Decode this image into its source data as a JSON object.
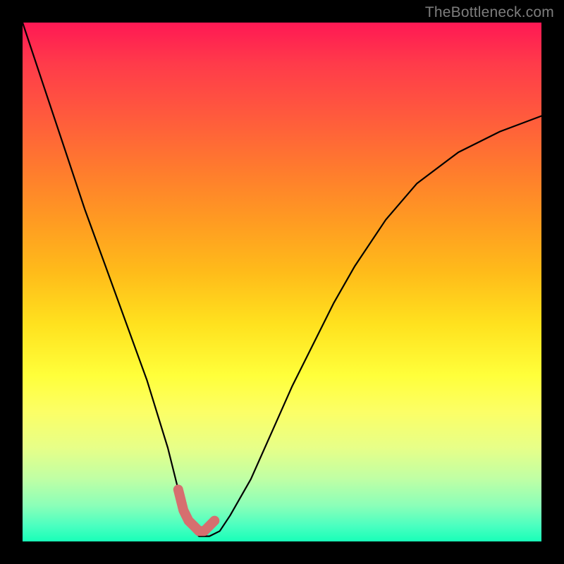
{
  "watermark": "TheBottleneck.com",
  "chart_data": {
    "type": "line",
    "title": "",
    "xlabel": "",
    "ylabel": "",
    "xlim": [
      0,
      100
    ],
    "ylim": [
      0,
      100
    ],
    "series": [
      {
        "name": "bottleneck-curve",
        "x": [
          0,
          4,
          8,
          12,
          16,
          20,
          24,
          28,
          30,
          32,
          33,
          34,
          36,
          38,
          40,
          44,
          48,
          52,
          56,
          60,
          64,
          70,
          76,
          84,
          92,
          100
        ],
        "values": [
          100,
          88,
          76,
          64,
          53,
          42,
          31,
          18,
          10,
          4,
          2,
          1,
          1,
          2,
          5,
          12,
          21,
          30,
          38,
          46,
          53,
          62,
          69,
          75,
          79,
          82
        ]
      },
      {
        "name": "highlight-segment",
        "x": [
          30,
          31,
          32,
          33,
          34,
          35,
          36,
          37
        ],
        "values": [
          10,
          6,
          4,
          3,
          2,
          2,
          3,
          4
        ]
      }
    ],
    "colors": {
      "curve": "#000000",
      "highlight": "#d66f6f",
      "gradient_top": "#ff1854",
      "gradient_bottom": "#18ffb8"
    }
  }
}
